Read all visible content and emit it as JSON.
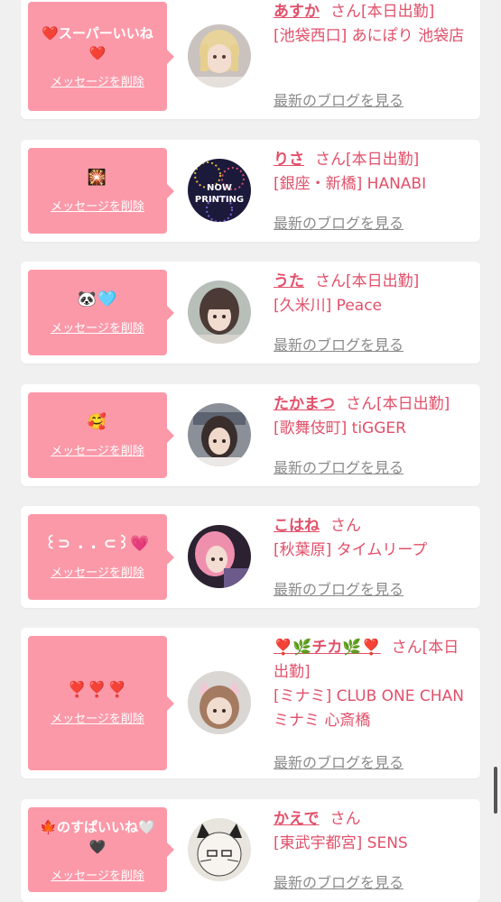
{
  "delete_label": "メッセージを削除",
  "blog_label": "最新のブログを見る",
  "san_label": "さん",
  "accent_color": "#e2506a",
  "bubble_color": "#fb99a9",
  "entries": [
    {
      "message": "❤️スーパーいいね❤️",
      "name": "あすか",
      "status": "[本日出勤]",
      "shop": "[池袋西口] あにぽり 池袋店"
    },
    {
      "message": "🎇",
      "name": "りさ",
      "status": "[本日出勤]",
      "shop": "[銀座・新橋] HANABI"
    },
    {
      "message": "🐼🩵",
      "name": "うた",
      "status": "[本日出勤]",
      "shop": "[久米川] Peace"
    },
    {
      "message": "🥰",
      "name": "たかまつ",
      "status": "[本日出勤]",
      "shop": "[歌舞伎町] tiGGER"
    },
    {
      "message": "꒰⊃ . . ⊂꒱💗",
      "name": "こはね",
      "status": "",
      "shop": "[秋葉原] タイムリープ"
    },
    {
      "message": "❣️❣️❣️",
      "name": "❣️🌿チカ🌿❣️",
      "status": "[本日出勤]",
      "shop": "[ミナミ] CLUB ONE CHAN ミナミ 心斎橋"
    },
    {
      "message": "🍁のすぱいいね🤍🖤",
      "name": "かえで",
      "status": "",
      "shop": "[東武宇都宮] SENS"
    }
  ],
  "avatar_2_text": "NOW PRINTING"
}
